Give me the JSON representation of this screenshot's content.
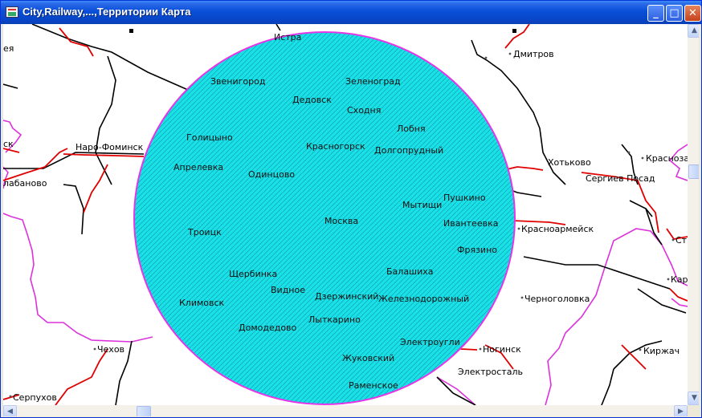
{
  "window": {
    "title": "City,Railway,...,Территории Карта",
    "minimize_glyph": "_",
    "maximize_glyph": "□",
    "close_glyph": "✕"
  },
  "colors": {
    "buffer_fill": "#19E1E6",
    "buffer_border": "#E436E8",
    "road": "#000000",
    "railway": "#E00000",
    "territory_border": "#DC32DC"
  },
  "map": {
    "inner_cities": [
      "Истра",
      "Звенигород",
      "Зеленоград",
      "Дедовск",
      "Сходня",
      "Лобня",
      "Голицыно",
      "Красногорск",
      "Долгопрудный",
      "Апрелевка",
      "Одинцово",
      "Пушкино",
      "Мытищи",
      "Москва",
      "Ивантеевка",
      "Троицк",
      "Фрязино",
      "Щербинка",
      "Балашиха",
      "Видное",
      "Климовск",
      "Дзержинский",
      "Железнодорожный",
      "Лыткарино",
      "Домодедово",
      "Электроугли",
      "Жуковский",
      "Раменское"
    ],
    "outer_cities": [
      "Дмитров",
      "Наро-Фоминск",
      "Хотьково",
      "Красноза",
      "Сергиев Посад",
      "Красноармейск",
      "Стр",
      "Кара",
      "Черноголовка",
      "Чехов",
      "Ногинск",
      "Киржач",
      "Электросталь",
      "Серпухов",
      "лабаново",
      "ея",
      "ск"
    ]
  },
  "scrollbars": {
    "up_arrow": "▲",
    "down_arrow": "▼",
    "left_arrow": "◀",
    "right_arrow": "▶"
  }
}
